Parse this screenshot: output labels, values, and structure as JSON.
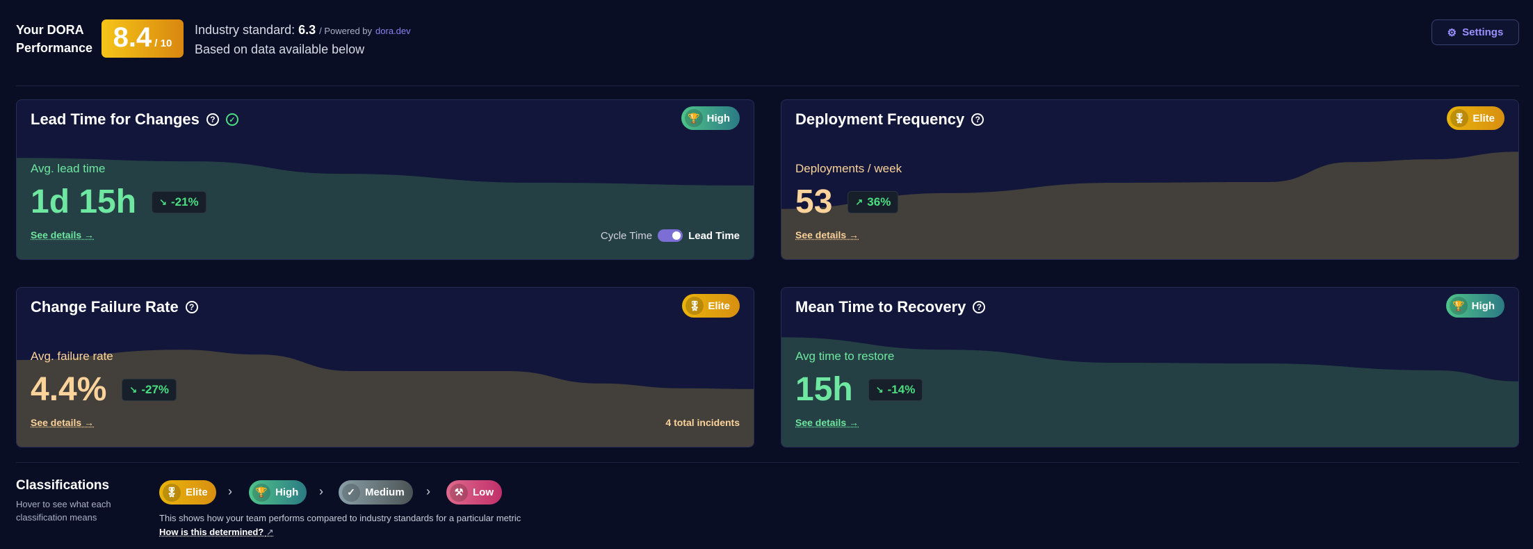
{
  "header": {
    "label_line1": "Your DORA",
    "label_line2": "Performance",
    "score": "8.4",
    "score_denominator": "/ 10",
    "industry_label": "Industry standard:",
    "industry_value": "6.3",
    "powered_by": "/ Powered by",
    "powered_link": "dora.dev",
    "based_on": "Based on data available below",
    "settings_label": "Settings"
  },
  "cards": [
    {
      "title": "Lead Time for Changes",
      "badge": "High",
      "subtitle": "Avg. lead time",
      "value": "1d 15h",
      "delta": "-21%",
      "delta_icon": "trend-down-icon",
      "details": "See details →",
      "toggle_left": "Cycle Time",
      "toggle_right": "Lead Time",
      "toggle_on": true,
      "area_color": "#254045"
    },
    {
      "title": "Deployment Frequency",
      "badge": "Elite",
      "subtitle": "Deployments / week",
      "value": "53",
      "delta": "36%",
      "delta_icon": "trend-up-icon",
      "details": "See details →",
      "area_color": "#433f3a"
    },
    {
      "title": "Change Failure Rate",
      "badge": "Elite",
      "subtitle": "Avg. failure rate",
      "value": "4.4%",
      "delta": "-27%",
      "delta_icon": "trend-down-icon",
      "details": "See details →",
      "footer_right": "4 total incidents",
      "area_color": "#433f3a"
    },
    {
      "title": "Mean Time to Recovery",
      "badge": "High",
      "subtitle": "Avg time to restore",
      "value": "15h",
      "delta": "-14%",
      "delta_icon": "trend-down-icon",
      "details": "See details →",
      "area_color": "#254045"
    }
  ],
  "classifications": {
    "title": "Classifications",
    "subtitle": "Hover to see what each classification means",
    "levels": [
      "Elite",
      "High",
      "Medium",
      "Low"
    ],
    "description": "This shows how your team performs compared to industry standards for a particular metric",
    "link": "How is this determined?"
  },
  "colors": {
    "background": "#090e25",
    "card": "#12163a",
    "green_text": "#6ee7a0",
    "tan_text": "#fcd39a",
    "accent": "#8b80f0"
  }
}
